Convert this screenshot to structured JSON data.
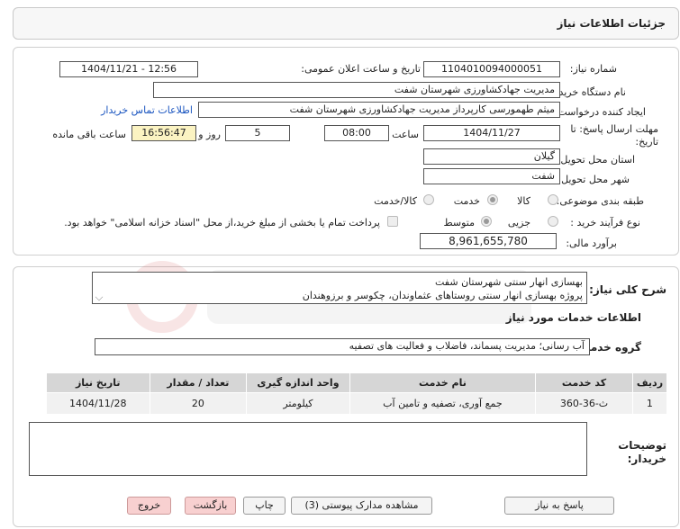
{
  "header": {
    "title": "جزئیات اطلاعات نیاز"
  },
  "form": {
    "need_number_label": "شماره نیاز:",
    "need_number": "1104010094000051",
    "announce_label": "تاریخ و ساعت اعلان عمومی:",
    "announce_value": "1404/11/21 - 12:56",
    "buyer_label": "نام دستگاه خریدار:",
    "buyer_value": "مدیریت جهادکشاورزی شهرستان شفت",
    "creator_label": "ایجاد کننده درخواست:",
    "creator_value": "میثم طهمورسی کارپرداز مدیریت جهادکشاورزی شهرستان شفت",
    "contact_link": "اطلاعات تماس خریدار",
    "deadline_label": "مهلت ارسال پاسخ: تا تاریخ:",
    "deadline_date": "1404/11/27",
    "time_label": "ساعت",
    "deadline_time": "08:00",
    "days_value": "5",
    "days_label": "روز و",
    "remaining_time": "16:56:47",
    "remaining_label": "ساعت باقی مانده",
    "province_label": "استان محل تحویل:",
    "province_value": "گیلان",
    "city_label": "شهر محل تحویل:",
    "city_value": "شفت",
    "category_label": "طبقه بندی موضوعی:",
    "category_options": [
      "کالا",
      "خدمت",
      "کالا/خدمت"
    ],
    "process_label": "نوع فرآیند خرید :",
    "process_options": [
      "جزیی",
      "متوسط"
    ],
    "payment_note": "پرداخت تمام یا بخشی از مبلغ خرید،از محل \"اسناد خزانه اسلامی\" خواهد بود.",
    "estimate_label": "برآورد مالی:",
    "estimate_value": "8,961,655,780"
  },
  "description": {
    "label": "شرح کلی نیاز:",
    "line1": "بهسازی انهار سنتی شهرستان شفت",
    "line2": "پروژه بهسازی انهار سنتی روستاهای عثماوندان، چکوسر و برزوهندان"
  },
  "services": {
    "section_title": "اطلاعات خدمات مورد نیاز",
    "group_label": "گروه خدمت:",
    "group_value": "آب رسانی؛ مدیریت پسماند، فاضلاب و فعالیت های تصفیه",
    "columns": [
      "ردیف",
      "کد خدمت",
      "نام خدمت",
      "واحد اندازه گیری",
      "تعداد / مقدار",
      "تاریخ نیاز"
    ],
    "rows": [
      [
        "1",
        "ث-36-360",
        "جمع آوری، تصفیه و تامین آب",
        "کیلومتر",
        "20",
        "1404/11/28"
      ]
    ]
  },
  "buyer_notes": {
    "label": "توضیحات خریدار:",
    "value": ""
  },
  "buttons": {
    "reply": "پاسخ به نیاز",
    "view_docs": "مشاهده مدارک پیوستی (3)",
    "print": "چاپ",
    "back": "بازگشت",
    "exit": "خروج"
  }
}
